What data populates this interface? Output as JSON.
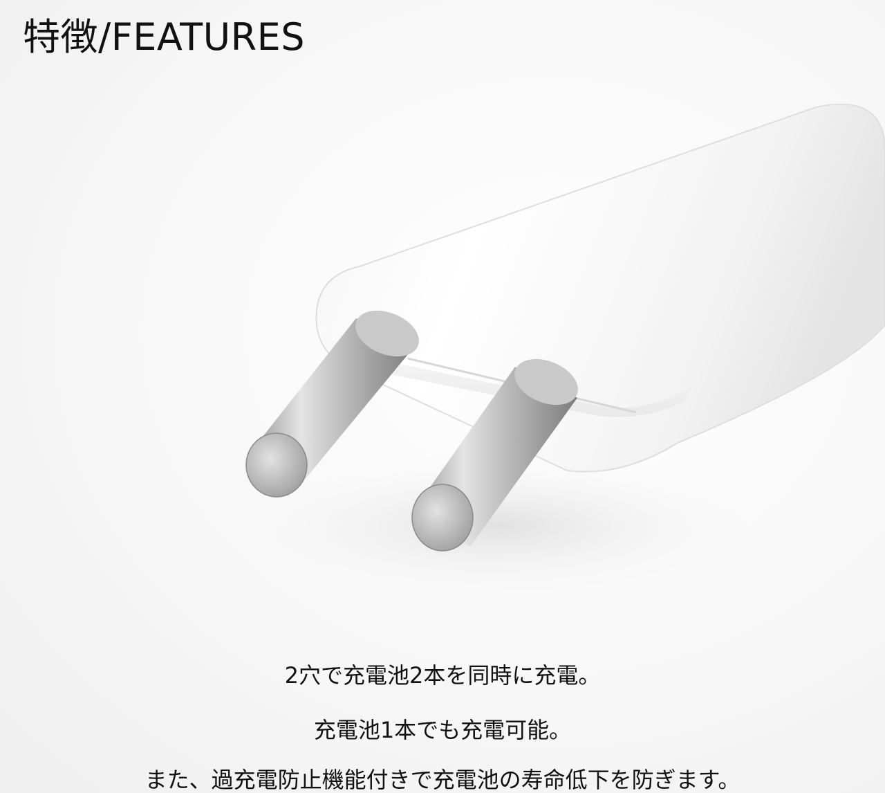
{
  "header": {
    "title": "特徴/FEATURES"
  },
  "product_image": {
    "subject": "charger-plug-with-two-metal-pins"
  },
  "features": [
    "2穴で充電池2本を同時に充電。",
    "充電池1本でも充電可能。",
    "また、過充電防止機能付きで充電池の寿命低下を防ぎます。"
  ]
}
